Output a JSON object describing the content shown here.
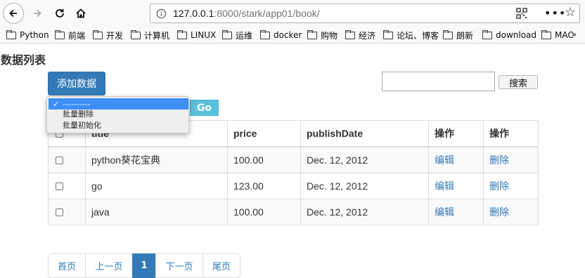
{
  "browser": {
    "url_host": "127.0.0.1",
    "url_rest": ":8000/stark/app01/book/",
    "bookmarks": [
      "Python",
      "前端",
      "开发",
      "计算机",
      "LINUX",
      "运维",
      "docker",
      "购物",
      "经济",
      "论坛、博客",
      "朗新",
      "download",
      "MAC"
    ],
    "more_chevron": "»"
  },
  "page": {
    "title": "数据列表",
    "add_button": "添加数据",
    "search_button": "搜索",
    "search_value": "",
    "go_button": "Go",
    "action_select": {
      "options": [
        "----------",
        "批量删除",
        "批量初始化"
      ],
      "selected_index": 0
    }
  },
  "table": {
    "headers": [
      "",
      "title",
      "price",
      "publishDate",
      "操作",
      "操作"
    ],
    "rows": [
      {
        "title": "python葵花宝典",
        "price": "100.00",
        "publishDate": "Dec. 12, 2012",
        "edit": "编辑",
        "delete": "删除"
      },
      {
        "title": "go",
        "price": "123.00",
        "publishDate": "Dec. 12, 2012",
        "edit": "编辑",
        "delete": "删除"
      },
      {
        "title": "java",
        "price": "100.00",
        "publishDate": "Dec. 12, 2012",
        "edit": "编辑",
        "delete": "删除"
      }
    ]
  },
  "pagination": {
    "first": "首页",
    "prev": "上一页",
    "current": "1",
    "next": "下一页",
    "last": "尾页"
  },
  "colors": {
    "primary": "#337ab7",
    "info": "#5bc0de",
    "dropdown_highlight": "#3d8ef7"
  }
}
